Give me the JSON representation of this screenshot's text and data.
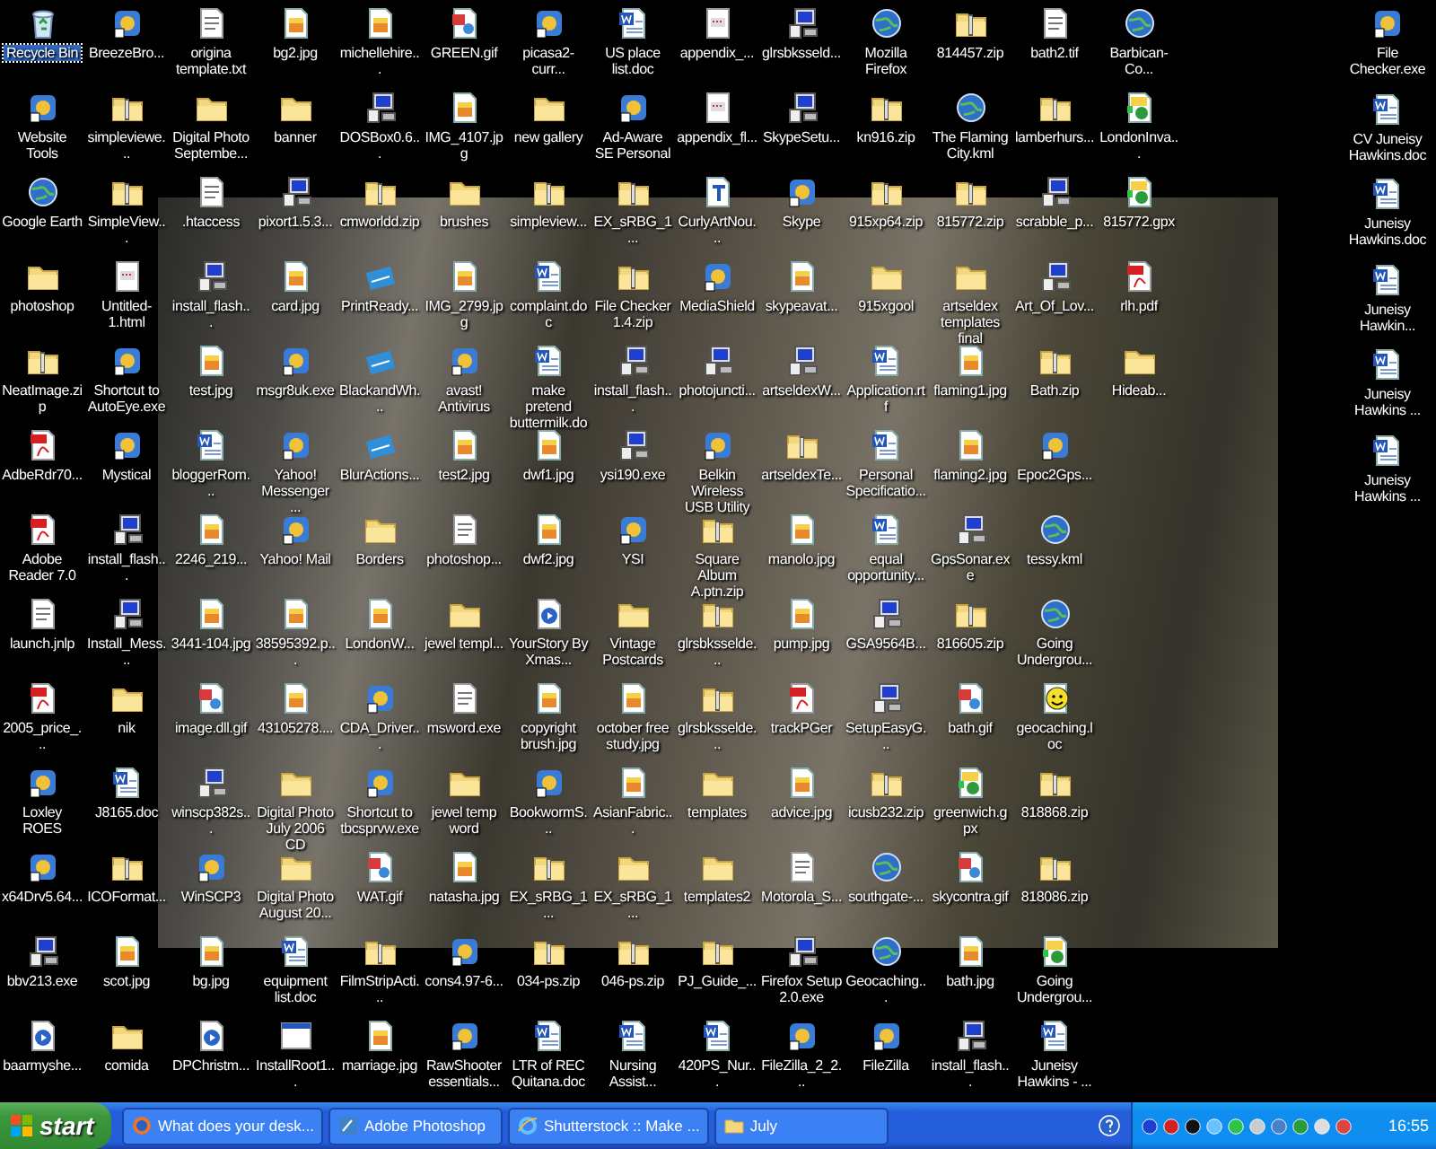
{
  "desktop": {
    "columns": [
      {
        "items": [
          {
            "label": "Recycle Bin",
            "kind": "bin",
            "selected": true
          },
          {
            "label": "Website Tools",
            "kind": "program",
            "selected": false
          },
          {
            "label": "Google Earth",
            "kind": "globe",
            "selected": false
          },
          {
            "label": "photoshop",
            "kind": "folder",
            "selected": false
          },
          {
            "label": "NeatImage.zip",
            "kind": "zip",
            "selected": false
          },
          {
            "label": "AdbeRdr70...",
            "kind": "pdf",
            "selected": false
          },
          {
            "label": "Adobe Reader 7.0",
            "kind": "pdf",
            "selected": false
          },
          {
            "label": "launch.jnlp",
            "kind": "text",
            "selected": false
          },
          {
            "label": "2005_price_...",
            "kind": "pdf",
            "selected": false
          },
          {
            "label": "Loxley ROES",
            "kind": "program",
            "selected": false
          },
          {
            "label": "x64Drv5.64...",
            "kind": "program",
            "selected": false
          },
          {
            "label": "bbv213.exe",
            "kind": "installer",
            "selected": false
          },
          {
            "label": "baarmyshe...",
            "kind": "media",
            "selected": false
          }
        ]
      },
      {
        "items": [
          {
            "label": "BreezeBro...",
            "kind": "program",
            "selected": false
          },
          {
            "label": "simpleviewe...",
            "kind": "zip",
            "selected": false
          },
          {
            "label": "SimpleView...",
            "kind": "zip",
            "selected": false
          },
          {
            "label": "Untitled-1.html",
            "kind": "web",
            "selected": false
          },
          {
            "label": "Shortcut to AutoEye.exe",
            "kind": "program",
            "selected": false
          },
          {
            "label": "Mystical",
            "kind": "program",
            "selected": false
          },
          {
            "label": "install_flash...",
            "kind": "installer",
            "selected": false
          },
          {
            "label": "Install_Mess...",
            "kind": "installer",
            "selected": false
          },
          {
            "label": "nik",
            "kind": "folder",
            "selected": false
          },
          {
            "label": "J8165.doc",
            "kind": "doc",
            "selected": false
          },
          {
            "label": "ICOFormat...",
            "kind": "zip",
            "selected": false
          },
          {
            "label": "scot.jpg",
            "kind": "image",
            "selected": false
          },
          {
            "label": "comida",
            "kind": "folder",
            "selected": false
          }
        ]
      },
      {
        "items": [
          {
            "label": "origina template.txt",
            "kind": "text",
            "selected": false
          },
          {
            "label": "Digital Photo Septembe...",
            "kind": "folder",
            "selected": false
          },
          {
            "label": ".htaccess",
            "kind": "text",
            "selected": false
          },
          {
            "label": "install_flash...",
            "kind": "installer",
            "selected": false
          },
          {
            "label": "test.jpg",
            "kind": "image",
            "selected": false
          },
          {
            "label": "bloggerRom...",
            "kind": "doc",
            "selected": false
          },
          {
            "label": "2246_219...",
            "kind": "image",
            "selected": false
          },
          {
            "label": "3441-104.jpg",
            "kind": "image",
            "selected": false
          },
          {
            "label": "image.dll.gif",
            "kind": "gif",
            "selected": false
          },
          {
            "label": "winscp382s...",
            "kind": "installer",
            "selected": false
          },
          {
            "label": "WinSCP3",
            "kind": "program",
            "selected": false
          },
          {
            "label": "bg.jpg",
            "kind": "image",
            "selected": false
          },
          {
            "label": "DPChristm...",
            "kind": "media",
            "selected": false
          }
        ]
      },
      {
        "items": [
          {
            "label": "bg2.jpg",
            "kind": "image",
            "selected": false
          },
          {
            "label": "banner",
            "kind": "folder",
            "selected": false
          },
          {
            "label": "pixort1.5.3...",
            "kind": "installer",
            "selected": false
          },
          {
            "label": "card.jpg",
            "kind": "image",
            "selected": false
          },
          {
            "label": "msgr8uk.exe",
            "kind": "program",
            "selected": false
          },
          {
            "label": "Yahoo! Messenger ...",
            "kind": "program",
            "selected": false
          },
          {
            "label": "Yahoo! Mail",
            "kind": "program",
            "selected": false
          },
          {
            "label": "38595392.p...",
            "kind": "image",
            "selected": false
          },
          {
            "label": "43105278....",
            "kind": "image",
            "selected": false
          },
          {
            "label": "Digital Photo July 2006 CD",
            "kind": "folder",
            "selected": false
          },
          {
            "label": "Digital Photo August 20...",
            "kind": "folder",
            "selected": false
          },
          {
            "label": "equipment list.doc",
            "kind": "doc",
            "selected": false
          },
          {
            "label": "InstallRoot1...",
            "kind": "window",
            "selected": false
          }
        ]
      },
      {
        "items": [
          {
            "label": "michellehire...",
            "kind": "image",
            "selected": false
          },
          {
            "label": "DOSBox0.6...",
            "kind": "installer",
            "selected": false
          },
          {
            "label": "cmworldd.zip",
            "kind": "zip",
            "selected": false
          },
          {
            "label": "PrintReady...",
            "kind": "action",
            "selected": false
          },
          {
            "label": "BlackandWh...",
            "kind": "action",
            "selected": false
          },
          {
            "label": "BlurActions...",
            "kind": "action",
            "selected": false
          },
          {
            "label": "Borders",
            "kind": "folder",
            "selected": false
          },
          {
            "label": "LondonW...",
            "kind": "image",
            "selected": false
          },
          {
            "label": "CDA_Driver...",
            "kind": "program",
            "selected": false
          },
          {
            "label": "Shortcut to tbcsprvw.exe",
            "kind": "program",
            "selected": false
          },
          {
            "label": "WAT.gif",
            "kind": "gif",
            "selected": false
          },
          {
            "label": "FilmStripActi...",
            "kind": "zip",
            "selected": false
          },
          {
            "label": "marriage.jpg",
            "kind": "image",
            "selected": false
          }
        ]
      },
      {
        "items": [
          {
            "label": "GREEN.gif",
            "kind": "gif",
            "selected": false
          },
          {
            "label": "IMG_4107.jpg",
            "kind": "image",
            "selected": false
          },
          {
            "label": "brushes",
            "kind": "folder",
            "selected": false
          },
          {
            "label": "IMG_2799.jpg",
            "kind": "image",
            "selected": false
          },
          {
            "label": "avast! Antivirus",
            "kind": "program",
            "selected": false
          },
          {
            "label": "test2.jpg",
            "kind": "image",
            "selected": false
          },
          {
            "label": "photoshop...",
            "kind": "text",
            "selected": false
          },
          {
            "label": "jewel templ...",
            "kind": "folder",
            "selected": false
          },
          {
            "label": "msword.exe",
            "kind": "text",
            "selected": false
          },
          {
            "label": "jewel temp word",
            "kind": "folder",
            "selected": false
          },
          {
            "label": "natasha.jpg",
            "kind": "image",
            "selected": false
          },
          {
            "label": "cons4.97-6...",
            "kind": "program",
            "selected": false
          },
          {
            "label": "RawShooter essentials...",
            "kind": "program",
            "selected": false
          }
        ]
      },
      {
        "items": [
          {
            "label": "picasa2-curr...",
            "kind": "program",
            "selected": false
          },
          {
            "label": "new gallery",
            "kind": "folder",
            "selected": false
          },
          {
            "label": "simpleview...",
            "kind": "zip",
            "selected": false
          },
          {
            "label": "complaint.doc",
            "kind": "doc",
            "selected": false
          },
          {
            "label": "make pretend buttermilk.doc",
            "kind": "doc",
            "selected": false
          },
          {
            "label": "dwf1.jpg",
            "kind": "image",
            "selected": false
          },
          {
            "label": "dwf2.jpg",
            "kind": "image",
            "selected": false
          },
          {
            "label": "YourStory By Xmas...",
            "kind": "media",
            "selected": false
          },
          {
            "label": "copyright brush.jpg",
            "kind": "image",
            "selected": false
          },
          {
            "label": "BookwormS...",
            "kind": "program",
            "selected": false
          },
          {
            "label": "EX_sRBG_1...",
            "kind": "zip",
            "selected": false
          },
          {
            "label": "034-ps.zip",
            "kind": "zip",
            "selected": false
          },
          {
            "label": "LTR of REC Quitana.doc",
            "kind": "doc",
            "selected": false
          }
        ]
      },
      {
        "items": [
          {
            "label": "US place list.doc",
            "kind": "doc",
            "selected": false
          },
          {
            "label": "Ad-Aware SE Personal",
            "kind": "program",
            "selected": false
          },
          {
            "label": "EX_sRBG_1...",
            "kind": "zip",
            "selected": false
          },
          {
            "label": "File Checker 1.4.zip",
            "kind": "zip",
            "selected": false
          },
          {
            "label": "install_flash...",
            "kind": "installer",
            "selected": false
          },
          {
            "label": "ysi190.exe",
            "kind": "installer",
            "selected": false
          },
          {
            "label": "YSI",
            "kind": "program",
            "selected": false
          },
          {
            "label": "Vintage Postcards",
            "kind": "folder",
            "selected": false
          },
          {
            "label": "october free study.jpg",
            "kind": "image",
            "selected": false
          },
          {
            "label": "AsianFabric...",
            "kind": "image",
            "selected": false
          },
          {
            "label": "EX_sRBG_1...",
            "kind": "folder",
            "selected": false
          },
          {
            "label": "046-ps.zip",
            "kind": "zip",
            "selected": false
          },
          {
            "label": "Nursing Assist...",
            "kind": "doc",
            "selected": false
          }
        ]
      },
      {
        "items": [
          {
            "label": "appendix_...",
            "kind": "web",
            "selected": false
          },
          {
            "label": "appendix_fl...",
            "kind": "web",
            "selected": false
          },
          {
            "label": "CurlyArtNou...",
            "kind": "font",
            "selected": false
          },
          {
            "label": "MediaShield",
            "kind": "program",
            "selected": false
          },
          {
            "label": "photojuncti...",
            "kind": "installer",
            "selected": false
          },
          {
            "label": "Belkin Wireless USB Utility",
            "kind": "program",
            "selected": false
          },
          {
            "label": "Square Album A.ptn.zip",
            "kind": "zip",
            "selected": false
          },
          {
            "label": "glrsbksselde...",
            "kind": "zip",
            "selected": false
          },
          {
            "label": "glrsbksselde...",
            "kind": "zip",
            "selected": false
          },
          {
            "label": "templates",
            "kind": "folder",
            "selected": false
          },
          {
            "label": "templates2",
            "kind": "folder",
            "selected": false
          },
          {
            "label": "PJ_Guide_...",
            "kind": "zip",
            "selected": false
          },
          {
            "label": "420PS_Nur...",
            "kind": "doc",
            "selected": false
          }
        ]
      },
      {
        "items": [
          {
            "label": "glrsbksseld...",
            "kind": "installer",
            "selected": false
          },
          {
            "label": "SkypeSetu...",
            "kind": "installer",
            "selected": false
          },
          {
            "label": "Skype",
            "kind": "program",
            "selected": false
          },
          {
            "label": "skypeavat...",
            "kind": "image",
            "selected": false
          },
          {
            "label": "artseldexW...",
            "kind": "installer",
            "selected": false
          },
          {
            "label": "artseldexTe...",
            "kind": "zip",
            "selected": false
          },
          {
            "label": "manolo.jpg",
            "kind": "image",
            "selected": false
          },
          {
            "label": "pump.jpg",
            "kind": "image",
            "selected": false
          },
          {
            "label": "trackPGer",
            "kind": "pdf",
            "selected": false
          },
          {
            "label": "advice.jpg",
            "kind": "image",
            "selected": false
          },
          {
            "label": "Motorola_S...",
            "kind": "text",
            "selected": false
          },
          {
            "label": "Firefox Setup 2.0.exe",
            "kind": "installer",
            "selected": false
          },
          {
            "label": "FileZilla_2_2...",
            "kind": "program",
            "selected": false
          }
        ]
      },
      {
        "items": [
          {
            "label": "Mozilla Firefox",
            "kind": "globe",
            "selected": false
          },
          {
            "label": "kn916.zip",
            "kind": "zip",
            "selected": false
          },
          {
            "label": "915xp64.zip",
            "kind": "zip",
            "selected": false
          },
          {
            "label": "915xgool",
            "kind": "folder",
            "selected": false
          },
          {
            "label": "Application.rtf",
            "kind": "doc",
            "selected": false
          },
          {
            "label": "Personal Specificatio...",
            "kind": "doc",
            "selected": false
          },
          {
            "label": "equal opportunity...",
            "kind": "doc",
            "selected": false
          },
          {
            "label": "GSA9564B...",
            "kind": "installer",
            "selected": false
          },
          {
            "label": "SetupEasyG...",
            "kind": "installer",
            "selected": false
          },
          {
            "label": "icusb232.zip",
            "kind": "zip",
            "selected": false
          },
          {
            "label": "southgate-...",
            "kind": "globe",
            "selected": false
          },
          {
            "label": "Geocaching...",
            "kind": "globe",
            "selected": false
          },
          {
            "label": "FileZilla",
            "kind": "program",
            "selected": false
          }
        ]
      },
      {
        "items": [
          {
            "label": "814457.zip",
            "kind": "zip",
            "selected": false
          },
          {
            "label": "The Flaming City.kml",
            "kind": "globe",
            "selected": false
          },
          {
            "label": "815772.zip",
            "kind": "zip",
            "selected": false
          },
          {
            "label": "artseldex templates final",
            "kind": "folder",
            "selected": false
          },
          {
            "label": "flaming1.jpg",
            "kind": "image",
            "selected": false
          },
          {
            "label": "flaming2.jpg",
            "kind": "image",
            "selected": false
          },
          {
            "label": "GpsSonar.exe",
            "kind": "installer",
            "selected": false
          },
          {
            "label": "816605.zip",
            "kind": "zip",
            "selected": false
          },
          {
            "label": "bath.gif",
            "kind": "gif",
            "selected": false
          },
          {
            "label": "greenwich.gpx",
            "kind": "gpx",
            "selected": false
          },
          {
            "label": "skycontra.gif",
            "kind": "gif",
            "selected": false
          },
          {
            "label": "bath.jpg",
            "kind": "image",
            "selected": false
          },
          {
            "label": "install_flash...",
            "kind": "installer",
            "selected": false
          }
        ]
      },
      {
        "items": [
          {
            "label": "bath2.tif",
            "kind": "text",
            "selected": false
          },
          {
            "label": "lamberhurs...",
            "kind": "zip",
            "selected": false
          },
          {
            "label": "scrabble_p...",
            "kind": "installer",
            "selected": false
          },
          {
            "label": "Art_Of_Lov...",
            "kind": "installer",
            "selected": false
          },
          {
            "label": "Bath.zip",
            "kind": "zip",
            "selected": false
          },
          {
            "label": "Epoc2Gps...",
            "kind": "program",
            "selected": false
          },
          {
            "label": "tessy.kml",
            "kind": "globe",
            "selected": false
          },
          {
            "label": "Going Undergrou...",
            "kind": "globe",
            "selected": false
          },
          {
            "label": "geocaching.loc",
            "kind": "smiley",
            "selected": false
          },
          {
            "label": "818868.zip",
            "kind": "zip",
            "selected": false
          },
          {
            "label": "818086.zip",
            "kind": "zip",
            "selected": false
          },
          {
            "label": "Going Undergrou...",
            "kind": "gpx",
            "selected": false
          },
          {
            "label": "Juneisy Hawkins - ...",
            "kind": "doc",
            "selected": false
          }
        ]
      },
      {
        "items": [
          {
            "label": "Barbican-Co...",
            "kind": "globe",
            "selected": false
          },
          {
            "label": "LondonInva...",
            "kind": "gpx",
            "selected": false
          },
          {
            "label": "815772.gpx",
            "kind": "gpx",
            "selected": false
          },
          {
            "label": "rlh.pdf",
            "kind": "pdf",
            "selected": false
          },
          {
            "label": "Hideab...",
            "kind": "folder",
            "selected": false
          }
        ]
      }
    ],
    "right_column": [
      {
        "label": "File Checker.exe",
        "kind": "program",
        "selected": false
      },
      {
        "label": "CV Juneisy Hawkins.doc",
        "kind": "doc",
        "selected": false
      },
      {
        "label": "Juneisy Hawkins.doc",
        "kind": "doc",
        "selected": false
      },
      {
        "label": "Juneisy Hawkin...",
        "kind": "doc",
        "selected": false
      },
      {
        "label": "Juneisy Hawkins ...",
        "kind": "doc",
        "selected": false
      },
      {
        "label": "Juneisy Hawkins ...",
        "kind": "doc",
        "selected": false
      }
    ]
  },
  "taskbar": {
    "start": "start",
    "tasks": [
      {
        "label": "What does your desk...",
        "kind": "browser",
        "selected": false
      },
      {
        "label": "Adobe Photoshop",
        "kind": "photoshop",
        "selected": false
      },
      {
        "label": "Shutterstock :: Make ...",
        "kind": "ie",
        "selected": false
      },
      {
        "label": "July",
        "kind": "folder",
        "selected": false
      }
    ],
    "clock": "16:55"
  }
}
